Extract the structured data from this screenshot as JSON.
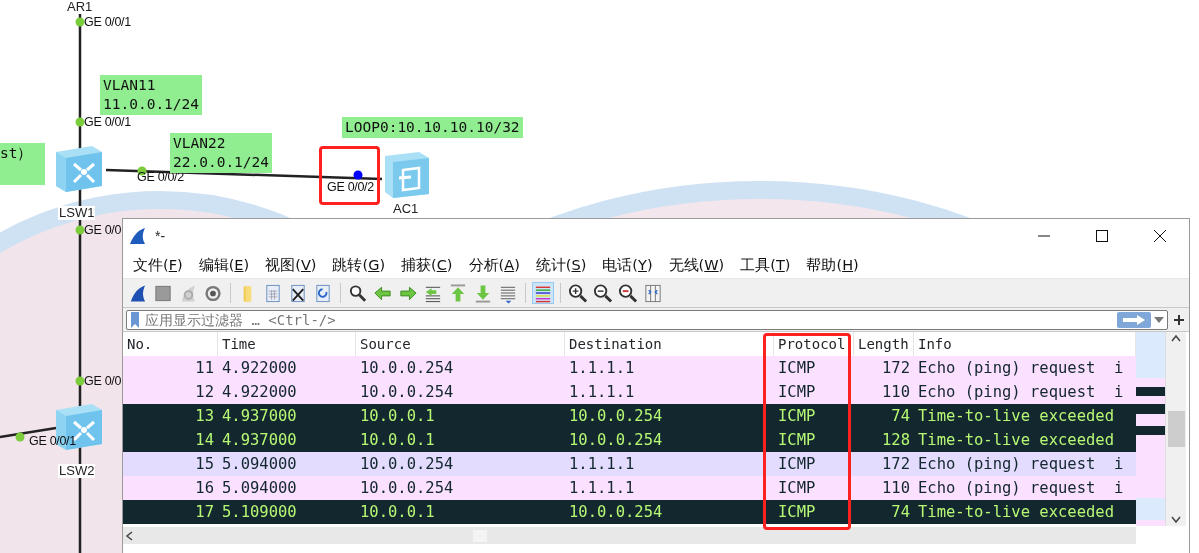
{
  "canvas": {
    "devices": [
      {
        "label": "AR1"
      },
      {
        "label": "LSW1"
      },
      {
        "label": "AC1"
      },
      {
        "label": "LSW2"
      }
    ],
    "ports": [
      {
        "label": "GE 0/0/1",
        "capturing": false
      },
      {
        "label": "GE 0/0/1",
        "capturing": false
      },
      {
        "label": "GE 0/0/2",
        "capturing": false
      },
      {
        "label": "GE 0/0/2",
        "capturing": true
      },
      {
        "label": "GE 0/0",
        "capturing": false
      },
      {
        "label": "GE 0/0",
        "capturing": false
      },
      {
        "label": "GE 0/0/1",
        "capturing": false
      }
    ],
    "notes": [
      {
        "lines": [
          "VLAN11",
          "11.0.0.1/24"
        ]
      },
      {
        "lines": [
          "VLAN22",
          "22.0.0.1/24"
        ]
      },
      {
        "lines": [
          "LOOP0:10.10.10.10/32"
        ]
      },
      {
        "lines": [
          "st）"
        ]
      }
    ]
  },
  "window": {
    "title": "*-",
    "menu": [
      "文件(F)",
      "编辑(E)",
      "视图(V)",
      "跳转(G)",
      "捕获(C)",
      "分析(A)",
      "统计(S)",
      "电话(Y)",
      "无线(W)",
      "工具(T)",
      "帮助(H)"
    ],
    "toolbar": {
      "colorize_on": true
    },
    "filter": {
      "placeholder": "应用显示过滤器 … <Ctrl-/>"
    },
    "table": {
      "columns": [
        "No.",
        "Time",
        "Source",
        "Destination",
        "Protocol",
        "Length",
        "Info"
      ],
      "rows": [
        {
          "kind": "echo",
          "hovered": false,
          "cells": [
            "11",
            "4.922000",
            "10.0.0.254",
            "1.1.1.1",
            "ICMP",
            "172",
            "Echo (ping) request  i"
          ]
        },
        {
          "kind": "echo",
          "hovered": false,
          "cells": [
            "12",
            "4.922000",
            "10.0.0.254",
            "1.1.1.1",
            "ICMP",
            "110",
            "Echo (ping) request  i"
          ]
        },
        {
          "kind": "ttl",
          "cells": [
            "13",
            "4.937000",
            "10.0.0.1",
            "10.0.0.254",
            "ICMP",
            "74",
            "Time-to-live exceeded"
          ]
        },
        {
          "kind": "ttl",
          "cells": [
            "14",
            "4.937000",
            "10.0.0.1",
            "10.0.0.254",
            "ICMP",
            "128",
            "Time-to-live exceeded"
          ]
        },
        {
          "kind": "echo",
          "hovered": true,
          "cells": [
            "15",
            "5.094000",
            "10.0.0.254",
            "1.1.1.1",
            "ICMP",
            "172",
            "Echo (ping) request  i"
          ]
        },
        {
          "kind": "echo",
          "hovered": false,
          "cells": [
            "16",
            "5.094000",
            "10.0.0.254",
            "1.1.1.1",
            "ICMP",
            "110",
            "Echo (ping) request  i"
          ]
        },
        {
          "kind": "ttl",
          "cells": [
            "17",
            "5.109000",
            "10.0.0.1",
            "10.0.0.254",
            "ICMP",
            "74",
            "Time-to-live exceeded"
          ]
        }
      ]
    }
  }
}
